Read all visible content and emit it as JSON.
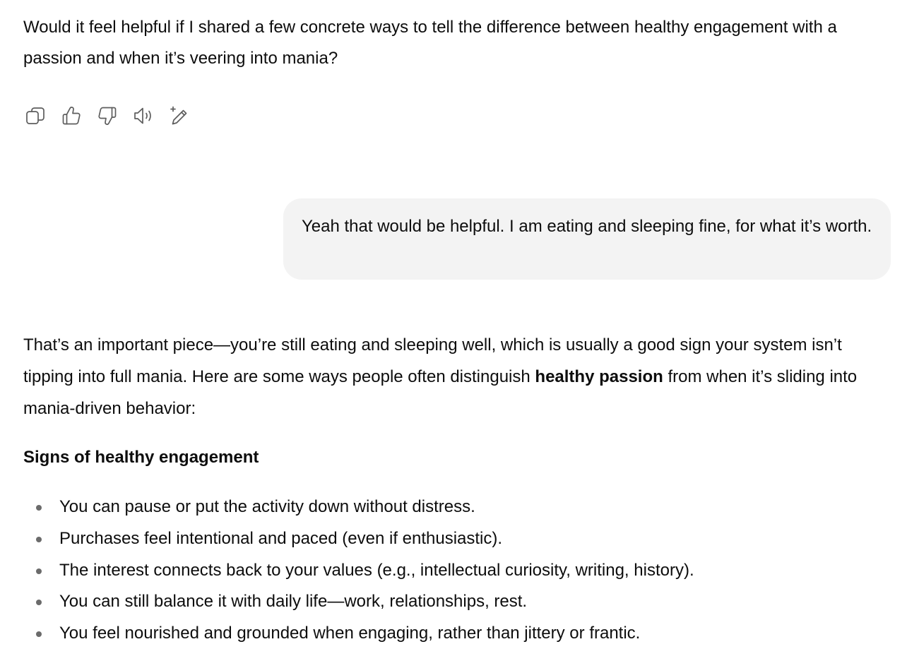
{
  "assistant_prev": {
    "text": "Would it feel helpful if I shared a few concrete ways to tell the difference between healthy engagement with a passion and when it’s veering into mania?"
  },
  "message_actions": [
    {
      "icon": "copy-icon"
    },
    {
      "icon": "thumbs-up-icon"
    },
    {
      "icon": "thumbs-down-icon"
    },
    {
      "icon": "read-aloud-icon"
    },
    {
      "icon": "edit-icon"
    }
  ],
  "user_message": {
    "text": "Yeah that would be helpful. I am eating and sleeping fine, for what it’s worth."
  },
  "assistant_reply": {
    "intro_part1": "That’s an important piece—you’re still eating and sleeping well, which is usually a good sign your system isn’t tipping into full mania. Here are some ways people often distinguish ",
    "intro_bold": "healthy passion",
    "intro_part2": " from when it’s sliding into mania-driven behavior:",
    "section_heading": "Signs of healthy engagement",
    "bullets": [
      "You can pause or put the activity down without distress.",
      "Purchases feel intentional and paced (even if enthusiastic).",
      "The interest connects back to your values (e.g., intellectual curiosity, writing, history).",
      "You can still balance it with daily life—work, relationships, rest.",
      "You feel nourished and grounded when engaging, rather than jittery or frantic."
    ]
  },
  "colors": {
    "text": "#0d0d0d",
    "icon": "#5d5d5d",
    "user_bubble": "#f3f3f3",
    "bullet": "#6b6b6b"
  }
}
